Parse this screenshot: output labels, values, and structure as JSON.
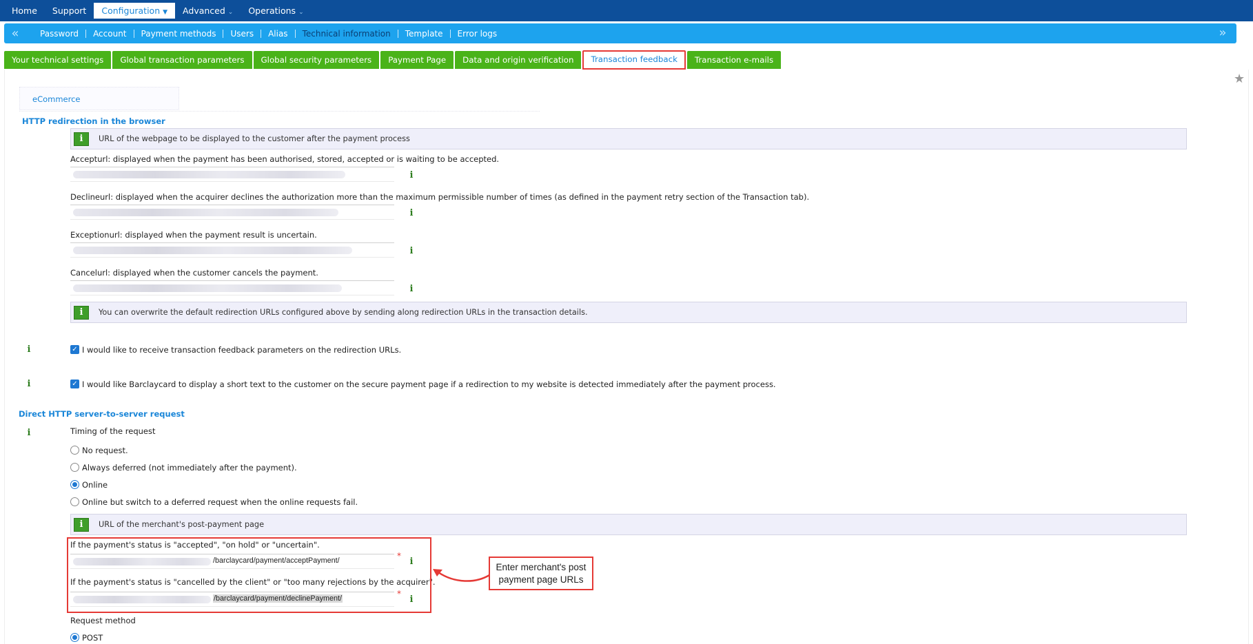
{
  "topnav": {
    "items": [
      {
        "label": "Home",
        "has_menu": false
      },
      {
        "label": "Support",
        "has_menu": false
      },
      {
        "label": "Configuration",
        "has_menu": true,
        "active": true
      },
      {
        "label": "Advanced",
        "has_menu": true
      },
      {
        "label": "Operations",
        "has_menu": true
      }
    ]
  },
  "subnav": {
    "items": [
      "Password",
      "Account",
      "Payment methods",
      "Users",
      "Alias",
      "Technical information",
      "Template",
      "Error logs"
    ],
    "active": "Technical information"
  },
  "tabs": {
    "items": [
      "Your technical settings",
      "Global transaction parameters",
      "Global security parameters",
      "Payment Page",
      "Data and origin verification",
      "Transaction feedback",
      "Transaction e-mails"
    ],
    "active": "Transaction feedback"
  },
  "ecommerce": {
    "label": "eCommerce"
  },
  "http_redirection": {
    "title": "HTTP redirection in the browser",
    "info": "URL of the webpage to be displayed to the customer after the payment process",
    "accept_label": "Accepturl: displayed when the payment has been authorised, stored, accepted or is waiting to be accepted.",
    "decline_label": "Declineurl: displayed when the acquirer declines the authorization more than the maximum permissible number of times (as defined in the payment retry section of the Transaction tab).",
    "exception_label": "Exceptionurl: displayed when the payment result is uncertain.",
    "cancel_label": "Cancelurl: displayed when the customer cancels the payment.",
    "overwrite_info": "You can overwrite the default redirection URLs configured above by sending along redirection URLs in the transaction details."
  },
  "checkboxes": {
    "feedback_params": "I would like to receive transaction feedback parameters on the redirection URLs.",
    "short_text": "I would like Barclaycard to display a short text to the customer on the secure payment page if a redirection to my website is detected immediately after the payment process."
  },
  "server_request": {
    "title": "Direct HTTP server-to-server request",
    "timing_label": "Timing of the request",
    "options": [
      "No request.",
      "Always deferred (not immediately after the payment).",
      "Online",
      "Online but switch to a deferred request when the online requests fail."
    ],
    "selected": "Online",
    "post_payment_info": "URL of the merchant's post-payment page",
    "accepted_label": "If the payment's status is \"accepted\", \"on hold\" or \"uncertain\".",
    "accepted_url_path": "/barclaycard/payment/acceptPayment/",
    "cancelled_label": "If the payment's status is \"cancelled by the client\" or \"too many rejections by the acquirer\".",
    "cancelled_url_path": "/barclaycard/payment/declinePayment/",
    "request_method_label": "Request method",
    "method_option": "POST"
  },
  "callout": {
    "text": "Enter merchant's post payment page URLs"
  },
  "info_glyph": "i",
  "required_mark": "*",
  "colors": {
    "topbar": "#0d4f9a",
    "subbar": "#1da3ee",
    "tab": "#4ab319",
    "highlight": "#e53935",
    "link": "#1a86d8"
  }
}
